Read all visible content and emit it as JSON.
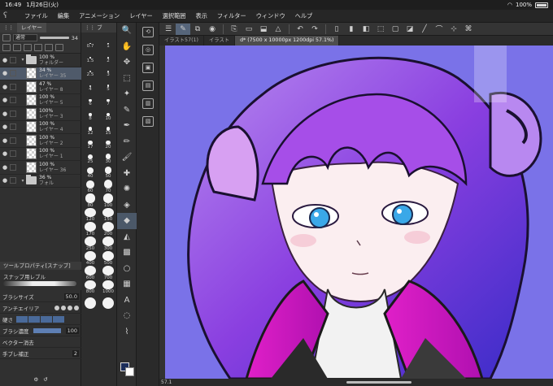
{
  "status": {
    "time": "16:49",
    "date": "1月26日(火)",
    "battery": "100%"
  },
  "menu": [
    "ファイル",
    "編集",
    "アニメーション",
    "レイヤー",
    "選択範囲",
    "表示",
    "フィルター",
    "ウィンドウ",
    "ヘルプ"
  ],
  "layer_panel": {
    "tab": "レイヤー",
    "blend_mode": "通常",
    "opacity": "34",
    "layers": [
      {
        "kind": "folder",
        "pct": "100 %",
        "name": "フォルダー",
        "sel": false
      },
      {
        "kind": "layer",
        "pct": "34 %",
        "name": "レイヤー 35",
        "sel": true
      },
      {
        "kind": "layer",
        "pct": "47 %",
        "name": "レイヤー 8",
        "sel": false
      },
      {
        "kind": "layer",
        "pct": "100 %",
        "name": "レイヤー 5",
        "sel": false
      },
      {
        "kind": "layer",
        "pct": "100%",
        "name": "レイヤー 3",
        "sel": false
      },
      {
        "kind": "layer",
        "pct": "100 %",
        "name": "レイヤー 4",
        "sel": false
      },
      {
        "kind": "layer",
        "pct": "100 %",
        "name": "レイヤー 2",
        "sel": false
      },
      {
        "kind": "layer",
        "pct": "100 %",
        "name": "レイヤー 1",
        "sel": false
      },
      {
        "kind": "layer",
        "pct": "100 %",
        "name": "レイヤー 36",
        "sel": false
      },
      {
        "kind": "folder",
        "pct": "36 %",
        "name": "フォル",
        "sel": false
      }
    ]
  },
  "tool_property": {
    "header": "ツールプロパティ[スナップ]",
    "sub_tool": "スナップ用レブル",
    "brush_size_label": "ブラシサイズ",
    "brush_size": "50.0",
    "antialias_label": "アンチエイリア",
    "hardness_label": "硬さ",
    "density_label": "ブラシ濃度",
    "density": "100",
    "vector_label": "ベクター消去",
    "stabilize_label": "手ブレ補正",
    "stabilize": "2"
  },
  "brush_sizes": [
    "0.7",
    "1",
    "1.5",
    "2",
    "2.5",
    "3",
    "4",
    "5",
    "6",
    "7",
    "8",
    "10",
    "12",
    "15",
    "17",
    "20",
    "25",
    "30",
    "40",
    "50",
    "60",
    "70",
    "80",
    "100",
    "120",
    "150",
    "170",
    "200",
    "250",
    "300",
    "400",
    "500",
    "600",
    "700",
    "800",
    "1000",
    "",
    ""
  ],
  "doc_tabs": [
    {
      "label": "イラスト57(1)",
      "active": false
    },
    {
      "label": "イラスト",
      "active": false
    },
    {
      "label": "d* (7500 x 10000px 1200dpi 57.1%)",
      "active": true
    }
  ],
  "zoom": "57.1",
  "colors": {
    "main": "#1b2d5a",
    "sub": "#ffffff",
    "canvas_bg": "#7a72e8"
  }
}
